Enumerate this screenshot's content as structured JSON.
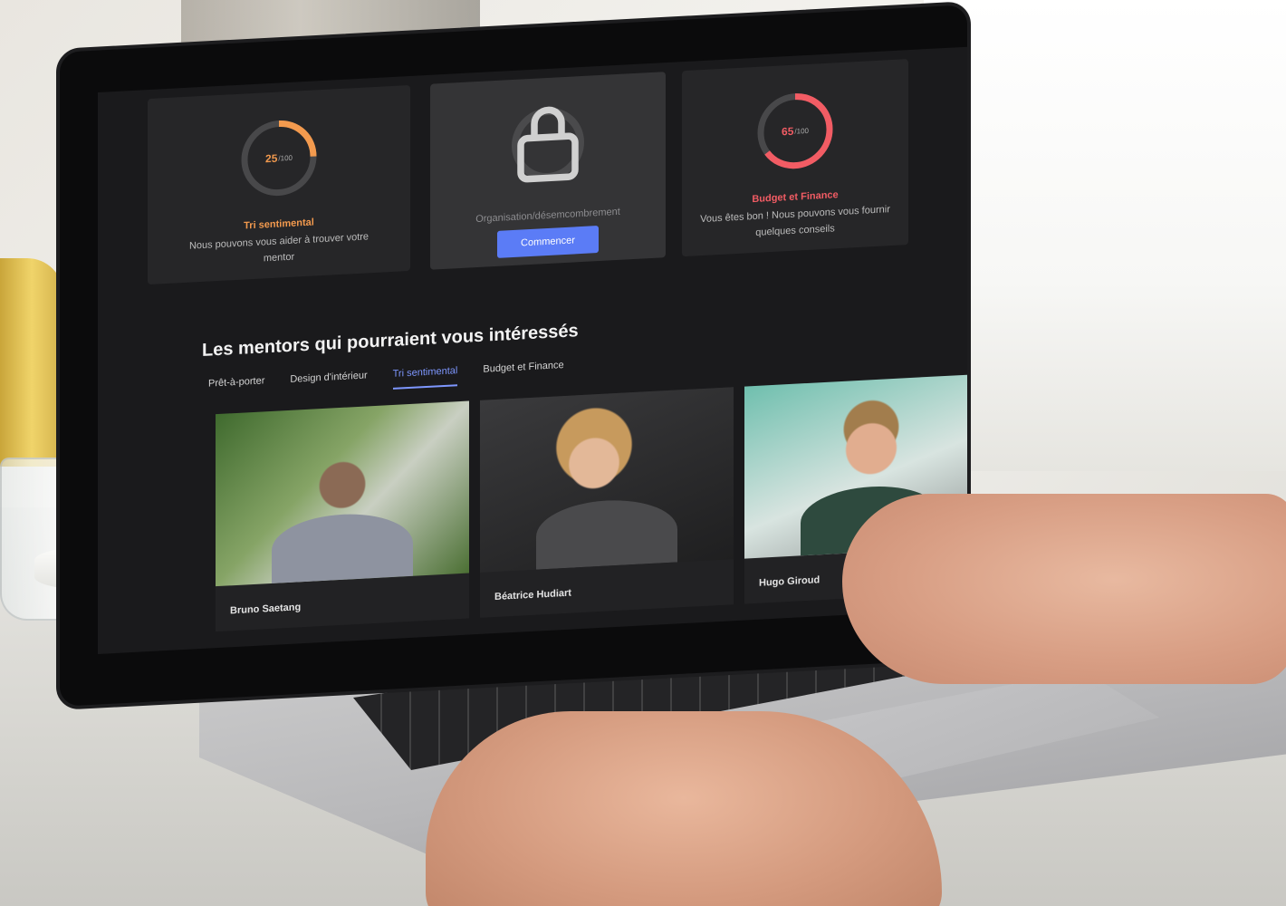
{
  "colors": {
    "screen_bg": "#1a1a1c",
    "card_bg": "#262628",
    "accent_orange": "#f39a4e",
    "accent_red": "#f25c64",
    "accent_blue": "#5b7cf6",
    "tab_active": "#7e97ff",
    "ring_track": "#48484a"
  },
  "cards": [
    {
      "score": "25",
      "score_max": "/100",
      "progress": 0.25,
      "title": "Tri sentimental",
      "description": "Nous pouvons vous aider à trouver votre mentor",
      "color": "#f39a4e"
    },
    {
      "icon": "lock-icon",
      "title": "Organisation/désemcombrement",
      "button": "Commencer"
    },
    {
      "score": "65",
      "score_max": "/100",
      "progress": 0.65,
      "title": "Budget et Finance",
      "description": "Vous êtes bon ! Nous pouvons vous fournir quelques conseils",
      "color": "#f25c64"
    }
  ],
  "mentors_section": {
    "title": "Les mentors qui pourraient vous intéressés",
    "tabs": [
      {
        "label": "Prêt-à-porter",
        "active": false
      },
      {
        "label": "Design d'intérieur",
        "active": false
      },
      {
        "label": "Tri sentimental",
        "active": true
      },
      {
        "label": "Budget et Finance",
        "active": false
      }
    ],
    "mentors": [
      {
        "name": "Bruno Saetang"
      },
      {
        "name": "Béatrice Hudiart"
      },
      {
        "name": "Hugo Giroud"
      }
    ]
  }
}
